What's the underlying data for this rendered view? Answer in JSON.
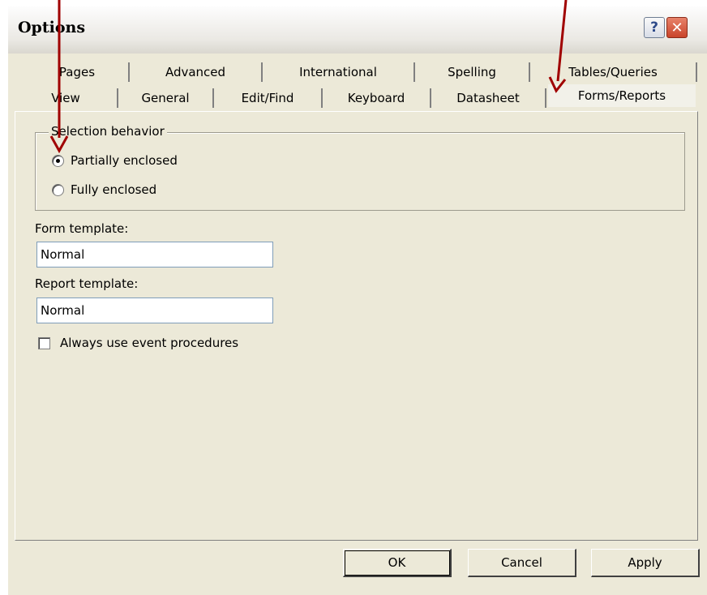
{
  "window": {
    "title": "Options"
  },
  "titlebar": {
    "help_glyph": "?",
    "close_glyph": "✕"
  },
  "tabs": {
    "row1": [
      "Pages",
      "Advanced",
      "International",
      "Spelling",
      "Tables/Queries"
    ],
    "row2": [
      "View",
      "General",
      "Edit/Find",
      "Keyboard",
      "Datasheet",
      "Forms/Reports"
    ],
    "active": "Forms/Reports"
  },
  "selection_behavior": {
    "legend": "Selection behavior",
    "options": [
      "Partially enclosed",
      "Fully enclosed"
    ],
    "selected": "Partially enclosed"
  },
  "form_template": {
    "label": "Form template:",
    "value": "Normal"
  },
  "report_template": {
    "label": "Report template:",
    "value": "Normal"
  },
  "event_procedures": {
    "label": "Always use event procedures",
    "checked": false
  },
  "buttons": {
    "ok": "OK",
    "cancel": "Cancel",
    "apply": "Apply"
  },
  "colors": {
    "dialog_bg": "#ece9d8",
    "annotation_arrow": "#a00000",
    "close_button": "#c9442a"
  }
}
